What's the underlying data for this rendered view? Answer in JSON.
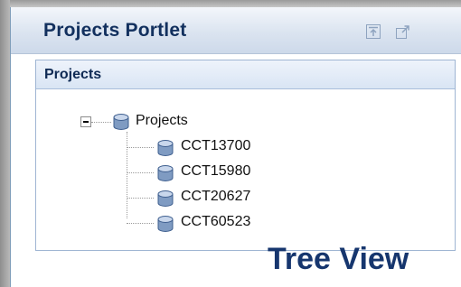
{
  "portlet": {
    "title": "Projects Portlet",
    "minimize_icon": "minimize-icon",
    "maximize_icon": "maximize-icon"
  },
  "section": {
    "title": "Projects"
  },
  "tree": {
    "root": {
      "label": "Projects",
      "expanded": true,
      "icon": "cylinder-icon"
    },
    "children": [
      {
        "label": "CCT13700",
        "icon": "cylinder-icon"
      },
      {
        "label": "CCT15980",
        "icon": "cylinder-icon"
      },
      {
        "label": "CCT20627",
        "icon": "cylinder-icon"
      },
      {
        "label": "CCT60523",
        "icon": "cylinder-icon"
      }
    ]
  },
  "caption": "Tree View",
  "colors": {
    "title": "#12305e",
    "caption": "#16366e",
    "node_icon": "#5f7fa8"
  }
}
